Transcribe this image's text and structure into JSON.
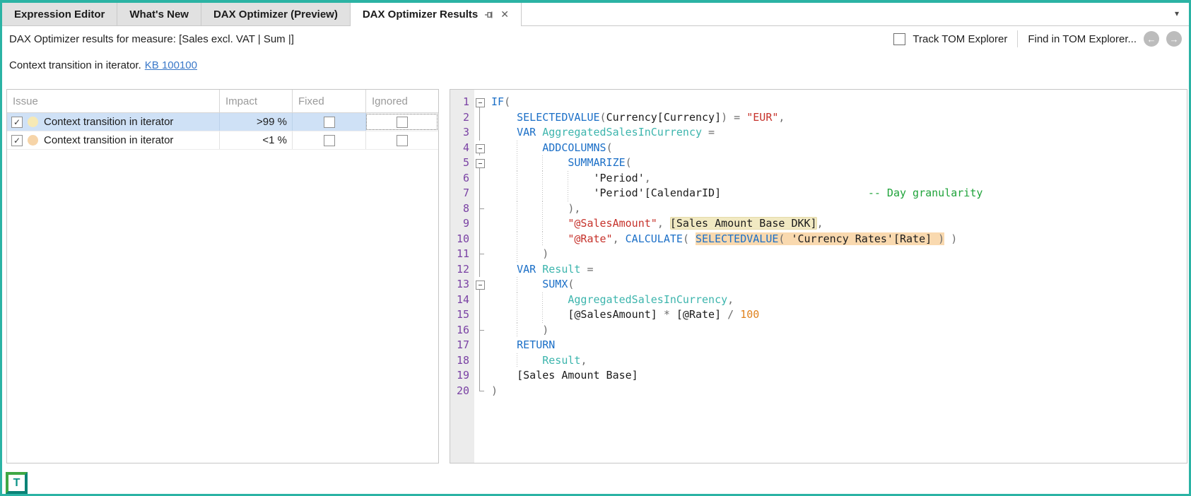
{
  "icons": {
    "back": "←",
    "forward": "→",
    "dropdown": "▾",
    "close": "✕",
    "check": "✓"
  },
  "tabs": [
    {
      "label": "Expression Editor",
      "active": false
    },
    {
      "label": "What's New",
      "active": false
    },
    {
      "label": "DAX Optimizer (Preview)",
      "active": false
    },
    {
      "label": "DAX Optimizer Results",
      "active": true
    }
  ],
  "toolbar": {
    "title": "DAX Optimizer results for measure: [Sales excl. VAT | Sum |]",
    "track_label": "Track TOM Explorer",
    "track_checked": false,
    "find_label": "Find in TOM Explorer..."
  },
  "banner": {
    "text": "Context transition in iterator.",
    "link": "KB 100100"
  },
  "issues_table": {
    "columns": [
      "Issue",
      "Impact",
      "Fixed",
      "Ignored"
    ],
    "rows": [
      {
        "checked": true,
        "dot_color": "#f6e9b5",
        "issue": "Context transition in iterator",
        "impact": ">99 %",
        "fixed": false,
        "ignored": false,
        "selected": true,
        "ignored_focused": true
      },
      {
        "checked": true,
        "dot_color": "#f6d4a8",
        "issue": "Context transition in iterator",
        "impact": "<1 %",
        "fixed": false,
        "ignored": false,
        "selected": false,
        "ignored_focused": false
      }
    ]
  },
  "editor": {
    "lines": [
      {
        "n": 1,
        "indent": 0,
        "fold": "box",
        "tokens": [
          [
            "kw",
            "IF"
          ],
          [
            "pu",
            "("
          ]
        ]
      },
      {
        "n": 2,
        "indent": 4,
        "fold": "line",
        "tokens": [
          [
            "kw",
            "SELECTEDVALUE"
          ],
          [
            "pu",
            "("
          ],
          [
            "pl",
            "Currency[Currency]"
          ],
          [
            "pu",
            ") = "
          ],
          [
            "st",
            "\"EUR\""
          ],
          [
            "pu",
            ","
          ]
        ]
      },
      {
        "n": 3,
        "indent": 4,
        "fold": "line",
        "tokens": [
          [
            "kw",
            "VAR"
          ],
          [
            "pl",
            " "
          ],
          [
            "va",
            "AggregatedSalesInCurrency"
          ],
          [
            "pu",
            " ="
          ]
        ]
      },
      {
        "n": 4,
        "indent": 8,
        "fold": "box",
        "tokens": [
          [
            "kw",
            "ADDCOLUMNS"
          ],
          [
            "pu",
            "("
          ]
        ]
      },
      {
        "n": 5,
        "indent": 12,
        "fold": "box",
        "tokens": [
          [
            "kw",
            "SUMMARIZE"
          ],
          [
            "pu",
            "("
          ]
        ]
      },
      {
        "n": 6,
        "indent": 16,
        "fold": "line",
        "tokens": [
          [
            "pl",
            "'Period'"
          ],
          [
            "pu",
            ","
          ]
        ]
      },
      {
        "n": 7,
        "indent": 16,
        "fold": "line",
        "tokens": [
          [
            "pl",
            "'Period'[CalendarID]"
          ],
          [
            "pl",
            "                       "
          ],
          [
            "cm",
            "-- Day granularity"
          ]
        ]
      },
      {
        "n": 8,
        "indent": 12,
        "fold": "end",
        "tokens": [
          [
            "pu",
            "),"
          ]
        ]
      },
      {
        "n": 9,
        "indent": 12,
        "fold": "line",
        "tokens": [
          [
            "st",
            "\"@SalesAmount\""
          ],
          [
            "pu",
            ", "
          ],
          [
            "pl",
            "[Sales Amount Base DKK]",
            "y"
          ],
          [
            "pu",
            ","
          ]
        ]
      },
      {
        "n": 10,
        "indent": 12,
        "fold": "line",
        "tokens": [
          [
            "st",
            "\"@Rate\""
          ],
          [
            "pu",
            ", "
          ],
          [
            "kw",
            "CALCULATE"
          ],
          [
            "pu",
            "( "
          ],
          [
            "kw",
            "SELECTEDVALUE",
            "o"
          ],
          [
            "pu",
            "( ",
            "o"
          ],
          [
            "pl",
            "'Currency Rates'[Rate]",
            "o"
          ],
          [
            "pu",
            " )",
            "o"
          ],
          [
            "pu",
            " )"
          ]
        ]
      },
      {
        "n": 11,
        "indent": 8,
        "fold": "end",
        "tokens": [
          [
            "pu",
            ")"
          ]
        ]
      },
      {
        "n": 12,
        "indent": 4,
        "fold": "line",
        "tokens": [
          [
            "kw",
            "VAR"
          ],
          [
            "pl",
            " "
          ],
          [
            "va",
            "Result"
          ],
          [
            "pu",
            " ="
          ]
        ]
      },
      {
        "n": 13,
        "indent": 8,
        "fold": "box",
        "tokens": [
          [
            "kw",
            "SUMX"
          ],
          [
            "pu",
            "("
          ]
        ]
      },
      {
        "n": 14,
        "indent": 12,
        "fold": "line",
        "tokens": [
          [
            "va",
            "AggregatedSalesInCurrency"
          ],
          [
            "pu",
            ","
          ]
        ]
      },
      {
        "n": 15,
        "indent": 12,
        "fold": "line",
        "tokens": [
          [
            "pl",
            "[@SalesAmount]"
          ],
          [
            "pu",
            " * "
          ],
          [
            "pl",
            "[@Rate]"
          ],
          [
            "pu",
            " / "
          ],
          [
            "nu",
            "100"
          ]
        ]
      },
      {
        "n": 16,
        "indent": 8,
        "fold": "end",
        "tokens": [
          [
            "pu",
            ")"
          ]
        ]
      },
      {
        "n": 17,
        "indent": 4,
        "fold": "line",
        "tokens": [
          [
            "kw",
            "RETURN"
          ]
        ]
      },
      {
        "n": 18,
        "indent": 8,
        "fold": "line",
        "tokens": [
          [
            "va",
            "Result"
          ],
          [
            "pu",
            ","
          ]
        ]
      },
      {
        "n": 19,
        "indent": 4,
        "fold": "line",
        "tokens": [
          [
            "pl",
            "[Sales Amount Base]"
          ]
        ]
      },
      {
        "n": 20,
        "indent": 0,
        "fold": "endstop",
        "tokens": [
          [
            "pu",
            ")"
          ]
        ]
      }
    ]
  },
  "logo": {
    "letter": "T"
  }
}
